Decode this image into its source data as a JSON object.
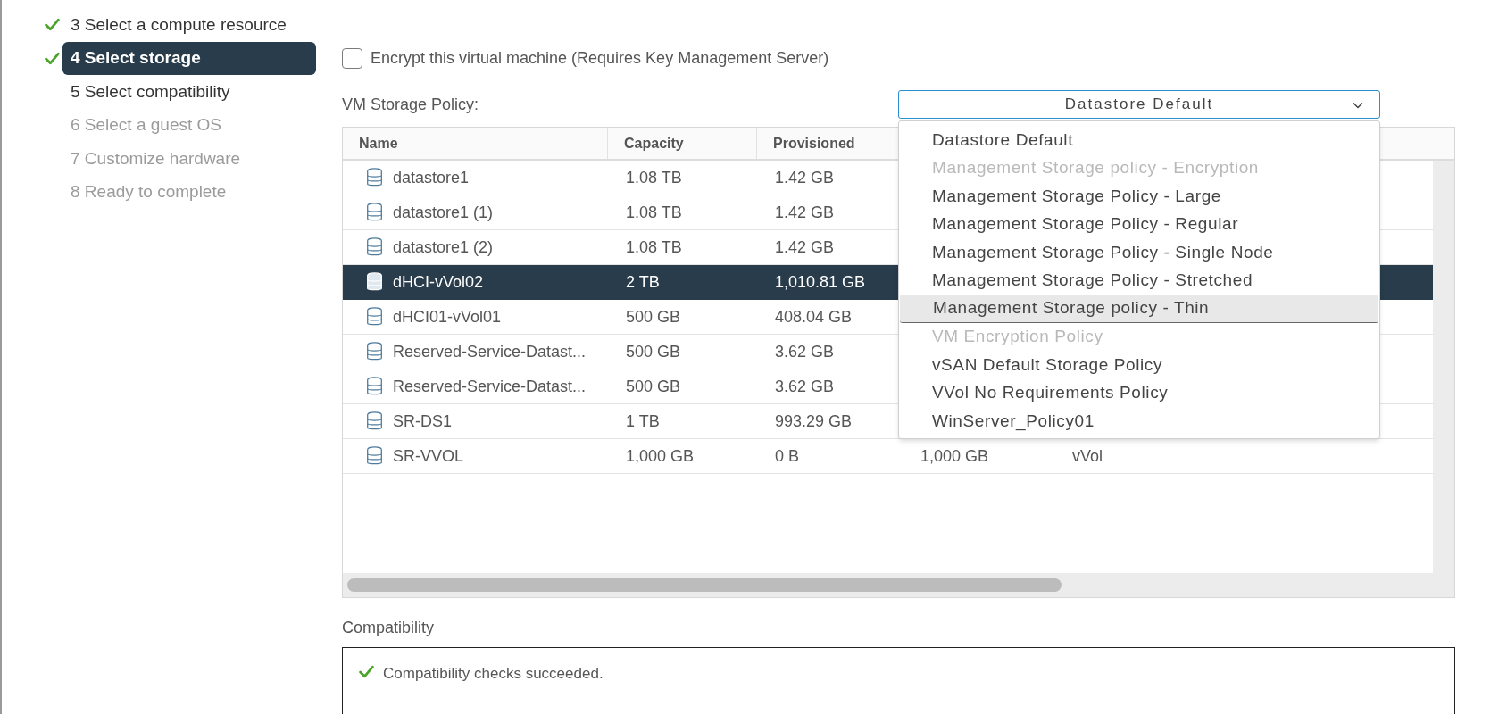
{
  "steps": [
    {
      "label": "3 Select a compute resource",
      "done": true,
      "selected": false,
      "disabled": false
    },
    {
      "label": "4 Select storage",
      "done": true,
      "selected": true,
      "disabled": false
    },
    {
      "label": "5 Select compatibility",
      "done": false,
      "selected": false,
      "disabled": false
    },
    {
      "label": "6 Select a guest OS",
      "done": false,
      "selected": false,
      "disabled": true
    },
    {
      "label": "7 Customize hardware",
      "done": false,
      "selected": false,
      "disabled": true
    },
    {
      "label": "8 Ready to complete",
      "done": false,
      "selected": false,
      "disabled": true
    }
  ],
  "encrypt": {
    "label": "Encrypt this virtual machine (Requires Key Management Server)",
    "checked": false
  },
  "storage_policy": {
    "label": "VM Storage Policy:",
    "value": "Datastore Default",
    "expanded": true,
    "options": [
      {
        "label": "Datastore Default",
        "disabled": false,
        "highlighted": false
      },
      {
        "label": "Management Storage policy - Encryption",
        "disabled": true,
        "highlighted": false
      },
      {
        "label": "Management Storage Policy - Large",
        "disabled": false,
        "highlighted": false
      },
      {
        "label": "Management Storage Policy - Regular",
        "disabled": false,
        "highlighted": false
      },
      {
        "label": "Management Storage Policy - Single Node",
        "disabled": false,
        "highlighted": false
      },
      {
        "label": "Management Storage Policy - Stretched",
        "disabled": false,
        "highlighted": false
      },
      {
        "label": "Management Storage policy - Thin",
        "disabled": false,
        "highlighted": true
      },
      {
        "label": "VM Encryption Policy",
        "disabled": true,
        "highlighted": false
      },
      {
        "label": "vSAN Default Storage Policy",
        "disabled": false,
        "highlighted": false
      },
      {
        "label": "VVol No Requirements Policy",
        "disabled": false,
        "highlighted": false
      },
      {
        "label": "WinServer_Policy01",
        "disabled": false,
        "highlighted": false
      }
    ]
  },
  "table": {
    "columns": [
      "Name",
      "Capacity",
      "Provisioned"
    ],
    "rows": [
      {
        "name": "datastore1",
        "capacity": "1.08 TB",
        "provisioned": "1.42 GB",
        "selected": false
      },
      {
        "name": "datastore1 (1)",
        "capacity": "1.08 TB",
        "provisioned": "1.42 GB",
        "selected": false
      },
      {
        "name": "datastore1 (2)",
        "capacity": "1.08 TB",
        "provisioned": "1.42 GB",
        "selected": false
      },
      {
        "name": "dHCI-vVol02",
        "capacity": "2 TB",
        "provisioned": "1,010.81 GB",
        "selected": true
      },
      {
        "name": "dHCI01-vVol01",
        "capacity": "500 GB",
        "provisioned": "408.04 GB",
        "selected": false
      },
      {
        "name": "Reserved-Service-Datast...",
        "capacity": "500 GB",
        "provisioned": "3.62 GB",
        "selected": false
      },
      {
        "name": "Reserved-Service-Datast...",
        "capacity": "500 GB",
        "provisioned": "3.62 GB",
        "selected": false
      },
      {
        "name": "SR-DS1",
        "capacity": "1 TB",
        "provisioned": "993.29 GB",
        "selected": false
      },
      {
        "name": "SR-VVOL",
        "capacity": "1,000 GB",
        "provisioned": "0 B",
        "column_4": "1,000 GB",
        "column_5": "vVol",
        "selected": false
      }
    ]
  },
  "compatibility": {
    "label": "Compatibility",
    "message": "Compatibility checks succeeded.",
    "ok": true
  }
}
